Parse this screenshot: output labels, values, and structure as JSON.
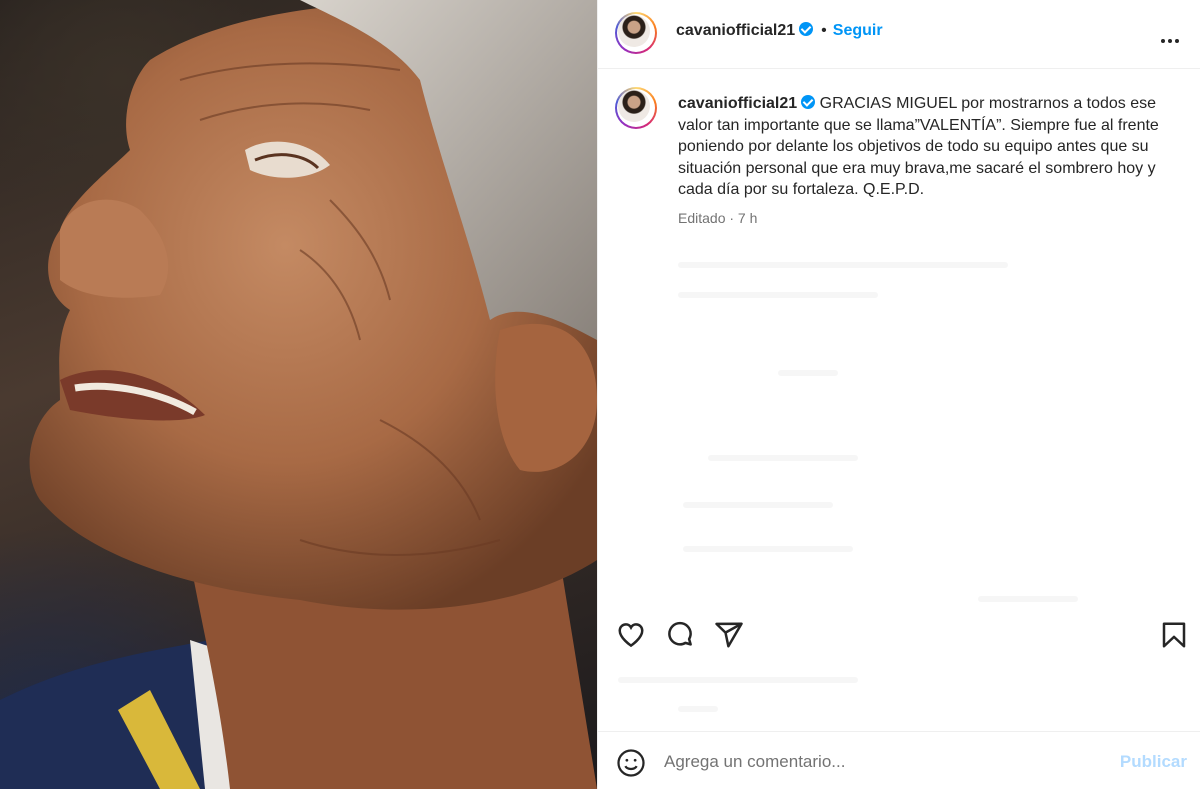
{
  "post": {
    "username": "cavaniofficial21",
    "verified": true,
    "follow_label": "Seguir",
    "separator": "•",
    "more_icon": "more-horizontal-icon"
  },
  "caption": {
    "username": "cavaniofficial21",
    "text": "GRACIAS MIGUEL por mostrarnos a todos ese valor tan importante que se llama”VALENTÍA”. Siempre fue al frente poniendo por delante los objetivos de todo su equipo antes que su situación personal que era muy brava,me sacaré el sombrero hoy y cada día por su fortaleza. Q.E.P.D.",
    "meta": "Editado · 7 h"
  },
  "actions": {
    "icons": [
      "heart-icon",
      "comment-icon",
      "share-icon",
      "bookmark-icon"
    ]
  },
  "comment": {
    "placeholder": "Agrega un comentario...",
    "publish_label": "Publicar",
    "emoji_icon": "emoji-icon"
  },
  "colors": {
    "accent": "#0095f6",
    "publish_disabled": "#b3dbff",
    "text": "#262626",
    "muted": "#737373",
    "border": "#efefef"
  }
}
